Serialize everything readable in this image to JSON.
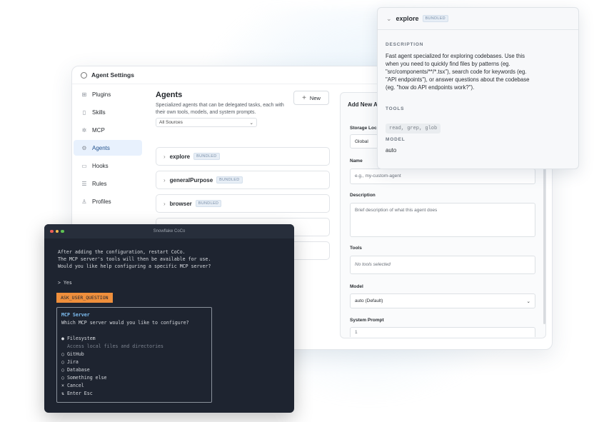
{
  "settings_window": {
    "title": "Agent Settings",
    "sidebar": [
      {
        "label": "Plugins",
        "icon": "plugins-icon",
        "active": false
      },
      {
        "label": "Skills",
        "icon": "skills-icon",
        "active": false
      },
      {
        "label": "MCP",
        "icon": "mcp-icon",
        "active": false
      },
      {
        "label": "Agents",
        "icon": "agents-icon",
        "active": true
      },
      {
        "label": "Hooks",
        "icon": "hooks-icon",
        "active": false
      },
      {
        "label": "Rules",
        "icon": "rules-icon",
        "active": false
      },
      {
        "label": "Profiles",
        "icon": "profiles-icon",
        "active": false
      }
    ],
    "agents": {
      "title": "Agents",
      "description": "Specialized agents that can be delegated tasks, each with their own tools, models, and system prompts.",
      "new_button": "New",
      "source_filter": "All Sources",
      "list": [
        {
          "name": "explore",
          "badge": "BUNDLED"
        },
        {
          "name": "generalPurpose",
          "badge": "BUNDLED"
        },
        {
          "name": "browser",
          "badge": "BUNDLED"
        }
      ]
    },
    "new_agent": {
      "title": "Add New A",
      "storage_label": "Storage Loc",
      "storage_value": "Global",
      "name_label": "Name",
      "name_placeholder": "e.g., my-custom-agent",
      "description_label": "Description",
      "description_placeholder": "Brief description of what this agent does",
      "tools_label": "Tools",
      "tools_value": "No tools selected",
      "model_label": "Model",
      "model_value": "auto (Default)",
      "system_prompt_label": "System Prompt",
      "system_prompt_value": "1"
    }
  },
  "explore_popup": {
    "name": "explore",
    "badge": "BUNDLED",
    "description_label": "DESCRIPTION",
    "description_lines": [
      "Fast agent specialized for exploring codebases. Use this",
      "when you need to quickly find files by patterns (eg.",
      "\"src/components/**/*.tsx\"), search code for keywords (eg.",
      "\"API endpoints\"), or answer questions about the codebase",
      "(eg. \"how do API endpoints work?\")."
    ],
    "tools_label": "TOOLS",
    "tools_value": "read, grep, glob",
    "model_label": "MODEL",
    "model_value": "auto"
  },
  "terminal": {
    "title": "Snowflake CoCo",
    "lines": [
      "After adding the configuration, restart CoCo.",
      "The MCP server's tools will then be available for use.",
      "Would you like help configuring a specific MCP server?"
    ],
    "answer": "> Yes",
    "ask_label": "ASK_USER_QUESTION",
    "mcp": {
      "heading": "MCP Server",
      "question": "Which MCP server would you like to configure?",
      "selected_option": "● Filesystem",
      "selected_hint": "Access local files and directories",
      "options": [
        "○ GitHub",
        "○ Jira",
        "○ Database",
        "○ Something else"
      ],
      "cancel": "× Cancel",
      "footer": "⇅ Enter Esc"
    },
    "colors": {
      "bg": "#1e2430",
      "accent": "#ef8f3c",
      "heading": "#7fc0f5"
    }
  }
}
